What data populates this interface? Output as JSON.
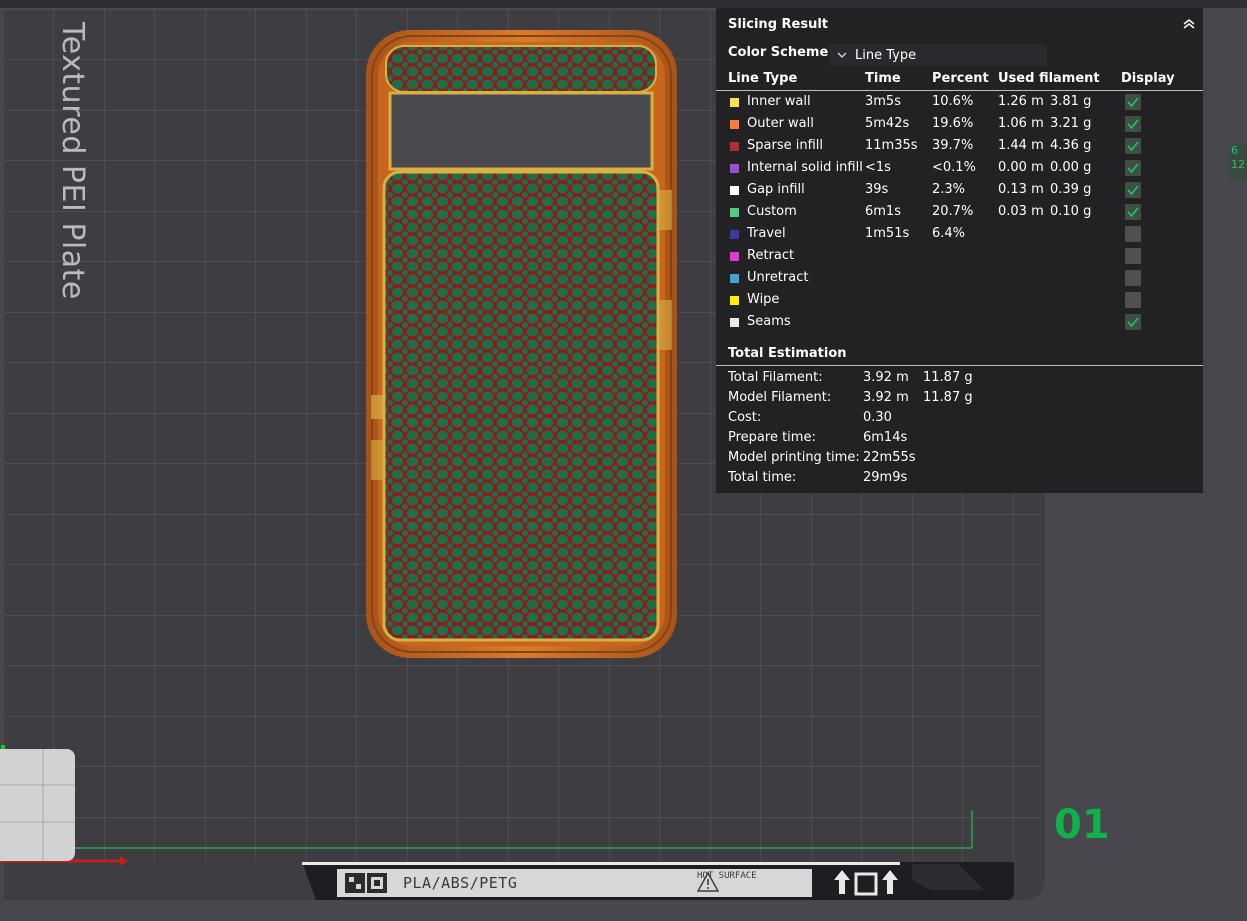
{
  "plate": {
    "title": "Textured PEI Plate",
    "number": "01",
    "side_readout": "6 12"
  },
  "panel": {
    "title": "Slicing Result",
    "color_scheme_label": "Color Scheme",
    "color_scheme_value": "Line Type",
    "columns": [
      "Line Type",
      "Time",
      "Percent",
      "Used filament",
      "Display"
    ],
    "rows": [
      {
        "name": "Inner wall",
        "time": "3m5s",
        "percent": "10.6%",
        "length": "1.26 m",
        "weight": "3.81 g",
        "display": true,
        "color": "#ffe14a"
      },
      {
        "name": "Outer wall",
        "time": "5m42s",
        "percent": "19.6%",
        "length": "1.06 m",
        "weight": "3.21 g",
        "display": true,
        "color": "#ff7d38"
      },
      {
        "name": "Sparse infill",
        "time": "11m35s",
        "percent": "39.7%",
        "length": "1.44 m",
        "weight": "4.36 g",
        "display": true,
        "color": "#b03030"
      },
      {
        "name": "Internal solid infill",
        "time": "<1s",
        "percent": "<0.1%",
        "length": "0.00 m",
        "weight": "0.00 g",
        "display": true,
        "color": "#9a4fd0"
      },
      {
        "name": "Gap infill",
        "time": "39s",
        "percent": "2.3%",
        "length": "0.13 m",
        "weight": "0.39 g",
        "display": true,
        "color": "#ffffff"
      },
      {
        "name": "Custom",
        "time": "6m1s",
        "percent": "20.7%",
        "length": "0.03 m",
        "weight": "0.10 g",
        "display": true,
        "color": "#4ecb8a"
      },
      {
        "name": "Travel",
        "time": "1m51s",
        "percent": "6.4%",
        "length": "",
        "weight": "",
        "display": false,
        "color": "#3a3a9e"
      },
      {
        "name": "Retract",
        "time": "",
        "percent": "",
        "length": "",
        "weight": "",
        "display": false,
        "color": "#e03bd0"
      },
      {
        "name": "Unretract",
        "time": "",
        "percent": "",
        "length": "",
        "weight": "",
        "display": false,
        "color": "#3fa3d6"
      },
      {
        "name": "Wipe",
        "time": "",
        "percent": "",
        "length": "",
        "weight": "",
        "display": false,
        "color": "#ffee00"
      },
      {
        "name": "Seams",
        "time": "",
        "percent": "",
        "length": "",
        "weight": "",
        "display": true,
        "color": "#eaeaea"
      }
    ],
    "estimation": {
      "title": "Total Estimation",
      "items": [
        {
          "label": "Total Filament:",
          "v1": "3.92 m",
          "v2": "11.87 g"
        },
        {
          "label": "Model Filament:",
          "v1": "3.92 m",
          "v2": "11.87 g"
        },
        {
          "label": "Cost:",
          "v1": "0.30",
          "v2": ""
        },
        {
          "label": "Prepare time:",
          "v1": "6m14s",
          "v2": ""
        },
        {
          "label": "Model printing time:",
          "v1": "22m55s",
          "v2": ""
        },
        {
          "label": "Total time:",
          "v1": "29m9s",
          "v2": ""
        }
      ]
    }
  },
  "bottom_bar": {
    "material_text": "PLA/ABS/PETG",
    "warning_text": "HOT SURFACE"
  },
  "colors": {
    "background": "#47474d",
    "plate": "#3e3e43",
    "grid": "#5a5a60",
    "accent_green": "#0fb24a",
    "print_orange": "#c8661e",
    "infill_green": "#1f6b47",
    "infill_red": "#8d1d1d"
  }
}
